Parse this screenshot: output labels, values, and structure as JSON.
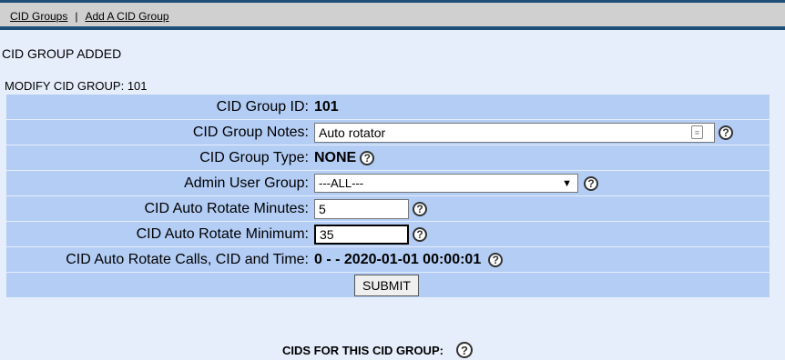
{
  "nav": {
    "link1": "CID Groups",
    "separator": "|",
    "link2": "Add A CID Group"
  },
  "status_message": "CID GROUP ADDED",
  "section_title": "MODIFY CID GROUP: 101",
  "fields": {
    "group_id": {
      "label": "CID Group ID:",
      "value": "101"
    },
    "notes": {
      "label": "CID Group Notes:",
      "value": "Auto rotator"
    },
    "type": {
      "label": "CID Group Type:",
      "value": "NONE"
    },
    "admin_group": {
      "label": "Admin User Group:",
      "value": "---ALL---"
    },
    "rotate_minutes": {
      "label": "CID Auto Rotate Minutes:",
      "value": "5"
    },
    "rotate_minimum": {
      "label": "CID Auto Rotate Minimum:",
      "value": "35"
    },
    "rotate_calls": {
      "label": "CID Auto Rotate Calls, CID and Time:",
      "value": "0 - - 2020-01-01 00:00:01"
    }
  },
  "submit_label": "SUBMIT",
  "cids_heading": "CIDS FOR THIS CID GROUP:",
  "help_glyph": "?",
  "icons": {
    "help": "help-circle-icon",
    "notes": "notepad-icon",
    "select": "chevron-down-icon"
  },
  "colors": {
    "header_bar": "#1f4e79",
    "row_bg": "#b3cdf5",
    "page_bg": "#e6eefb"
  }
}
